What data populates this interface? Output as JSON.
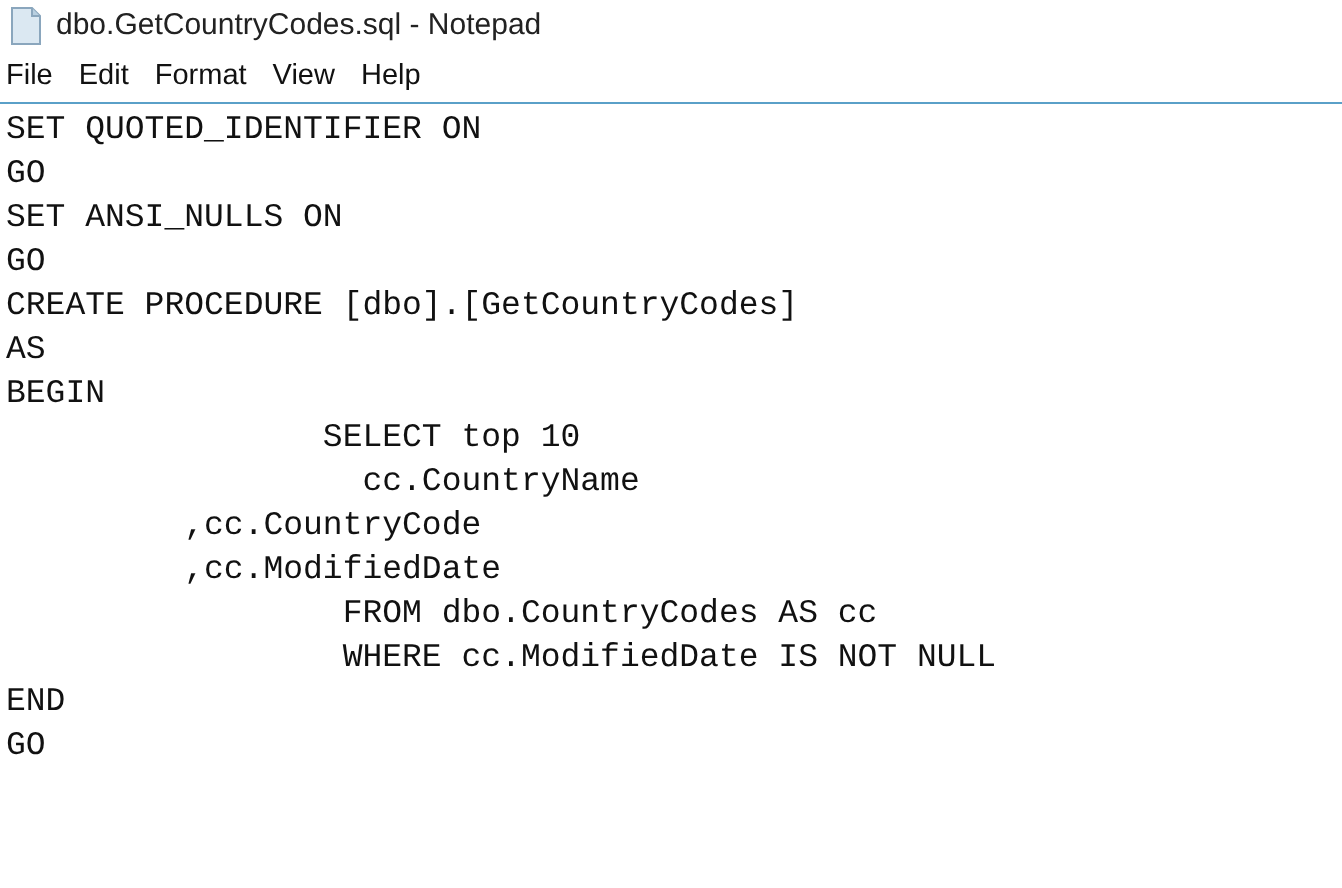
{
  "window": {
    "title": "dbo.GetCountryCodes.sql - Notepad"
  },
  "menu": [
    "File",
    "Edit",
    "Format",
    "View",
    "Help"
  ],
  "editor": {
    "lines": [
      "SET QUOTED_IDENTIFIER ON",
      "GO",
      "SET ANSI_NULLS ON",
      "GO",
      "CREATE PROCEDURE [dbo].[GetCountryCodes]",
      "AS",
      "BEGIN",
      "                SELECT top 10",
      "                  cc.CountryName",
      "         ,cc.CountryCode",
      "         ,cc.ModifiedDate",
      "                 FROM dbo.CountryCodes AS cc",
      "                 WHERE cc.ModifiedDate IS NOT NULL",
      "END",
      "GO"
    ]
  }
}
